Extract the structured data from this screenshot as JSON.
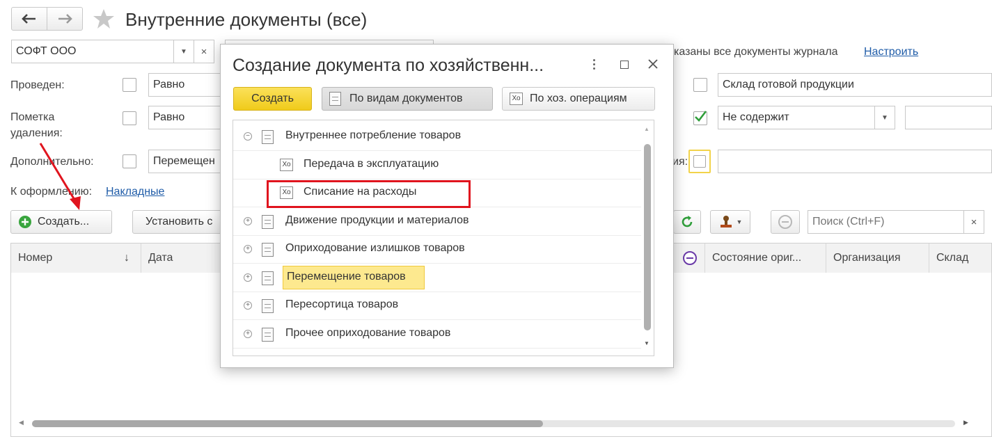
{
  "window": {
    "title": "Внутренние документы (все)"
  },
  "filters": {
    "organization": "СОФТ ООО",
    "posted_label": "Проведен:",
    "posted_condition": "Равно",
    "deletion_label_line1": "Пометка",
    "deletion_label_line2": "удаления:",
    "deletion_condition": "Равно",
    "additional_label": "Дополнительно:",
    "additional_value": "Перемещен",
    "journal_note": "казаны все документы журнала",
    "configure_link": "Настроить",
    "warehouse_value": "Склад готовой продукции",
    "contains_value": "Не содержит",
    "right_label_fragment": "ия:"
  },
  "to_process": {
    "label": "К оформлению:",
    "link": "Накладные"
  },
  "toolbar": {
    "create_label": "Создать...",
    "set_label": "Установить с",
    "search_placeholder": "Поиск (Ctrl+F)",
    "clear_symbol": "×"
  },
  "table": {
    "columns": [
      "Номер",
      "Дата",
      "Состояние ориг...",
      "Организация",
      "Склад"
    ],
    "sort_indicator": "↓"
  },
  "modal": {
    "title": "Создание документа по хозяйственн...",
    "create_button": "Создать",
    "by_doc_types_button": "По видам документов",
    "by_operations_button": "По хоз. операциям",
    "op_icon_text": "Хо",
    "items": [
      {
        "label": "Внутреннее потребление товаров",
        "kind": "group",
        "expanded": true
      },
      {
        "label": "Передача в эксплуатацию",
        "kind": "operation"
      },
      {
        "label": "Списание на расходы",
        "kind": "operation",
        "highlighted": true
      },
      {
        "label": "Движение продукции и материалов",
        "kind": "group"
      },
      {
        "label": "Оприходование излишков товаров",
        "kind": "group"
      },
      {
        "label": "Перемещение товаров",
        "kind": "group",
        "selected": true
      },
      {
        "label": "Пересортица товаров",
        "kind": "group"
      },
      {
        "label": "Прочее оприходование товаров",
        "kind": "group"
      }
    ]
  },
  "colors": {
    "accent_yellow": "#f5d327",
    "highlight_red": "#e0141e",
    "link_blue": "#1f5ca8",
    "selection_yellow": "#fde98f"
  }
}
